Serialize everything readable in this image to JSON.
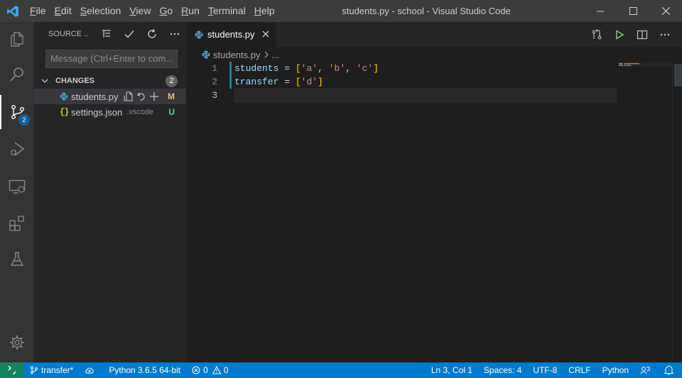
{
  "titlebar": {
    "logo_icon": "vscode-logo-icon",
    "menu": [
      {
        "pre": "",
        "mn": "F",
        "post": "ile"
      },
      {
        "pre": "",
        "mn": "E",
        "post": "dit"
      },
      {
        "pre": "",
        "mn": "S",
        "post": "election"
      },
      {
        "pre": "",
        "mn": "V",
        "post": "iew"
      },
      {
        "pre": "",
        "mn": "G",
        "post": "o"
      },
      {
        "pre": "",
        "mn": "R",
        "post": "un"
      },
      {
        "pre": "",
        "mn": "T",
        "post": "erminal"
      },
      {
        "pre": "",
        "mn": "H",
        "post": "elp"
      }
    ],
    "window_title": "students.py - school - Visual Studio Code"
  },
  "activity_bar": {
    "items": [
      "explorer-icon",
      "search-icon",
      "source-control-icon",
      "run-debug-icon",
      "remote-explorer-icon",
      "extensions-icon",
      "testing-icon"
    ],
    "scm_badge": "2",
    "manage_icon": "gear-icon"
  },
  "sidebar": {
    "title": "SOURCE ...",
    "commit_placeholder": "Message (Ctrl+Enter to com...",
    "changes_label": "CHANGES",
    "changes_count": "2",
    "files": [
      {
        "name": "students.py",
        "desc": "",
        "status": "M",
        "status_color": "#e2c08d"
      },
      {
        "name": "settings.json",
        "desc": ".vscode",
        "status": "U",
        "status_color": "#73c991"
      }
    ]
  },
  "editor": {
    "tab_label": "students.py",
    "breadcrumb_file": "students.py",
    "breadcrumb_more": "...",
    "line_numbers": [
      "1",
      "2",
      "3"
    ],
    "lines": [
      {
        "var": "students",
        "op": " = ",
        "open": "[",
        "items": [
          "'a'",
          "'b'",
          "'c'"
        ],
        "close": "]"
      },
      {
        "var": "transfer",
        "op": " = ",
        "open": "[",
        "items": [
          "'d'"
        ],
        "close": "]"
      }
    ],
    "list_sep": ", "
  },
  "statusbar": {
    "branch": "transfer*",
    "python": "Python 3.6.5 64-bit",
    "errors": "0",
    "warnings": "0",
    "cursor": "Ln 3, Col 1",
    "spaces": "Spaces: 4",
    "encoding": "UTF-8",
    "eol": "CRLF",
    "language": "Python"
  },
  "colors": {
    "accent": "#007acc",
    "remote": "#16825d",
    "modified": "#e2c08d",
    "untracked": "#73c991"
  }
}
